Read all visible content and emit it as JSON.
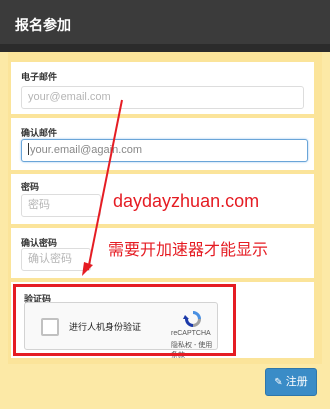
{
  "header": {
    "title": "报名参加"
  },
  "form": {
    "email": {
      "label": "电子邮件",
      "placeholder": "your@email.com"
    },
    "confirm_email": {
      "label": "确认邮件",
      "value": "your.email@again.com"
    },
    "password": {
      "label": "密码",
      "placeholder": "密码"
    },
    "confirm_password": {
      "label": "确认密码",
      "placeholder": "确认密码"
    },
    "captcha": {
      "label": "验证码",
      "checkbox_text": "进行人机身份验证",
      "brand": "reCAPTCHA",
      "terms": "隐私权 - 使用条款"
    },
    "submit": {
      "icon": "edit-icon",
      "label": "注册"
    }
  },
  "annotations": {
    "watermark": "daydayzhuan.com",
    "note": "需要开加速器才能显示"
  },
  "colors": {
    "header": "#3b3b3b",
    "panel": "#fbe49a",
    "accent": "#3a8cc7",
    "annotation": "#e51c23"
  }
}
